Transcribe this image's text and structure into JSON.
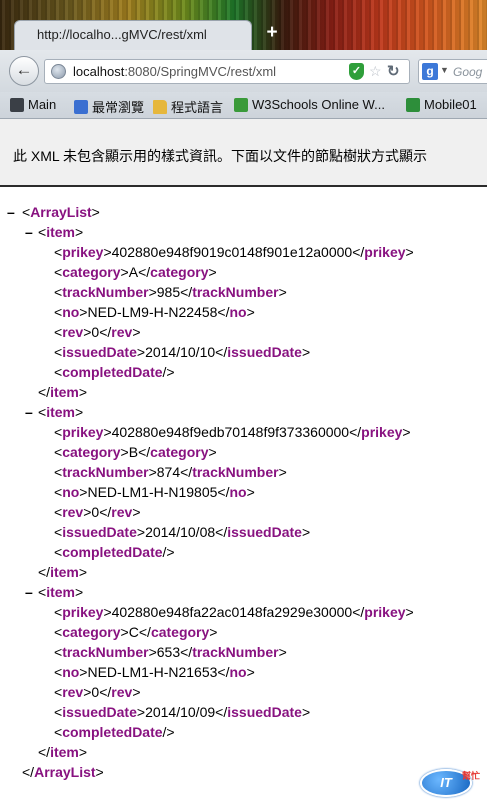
{
  "browser": {
    "tab_title": "http://localho...gMVC/rest/xml",
    "new_tab": "+",
    "url_host": "localhost",
    "url_rest": ":8080/SpringMVC/rest/xml",
    "search_engine": "g",
    "search_placeholder": "Goog",
    "bookmarks": [
      {
        "label": "Main",
        "icon": "page-icon"
      },
      {
        "label": "最常瀏覽",
        "icon": "people-icon"
      },
      {
        "label": "程式語言",
        "icon": "folder-icon"
      },
      {
        "label": "W3Schools Online W...",
        "icon": "w3schools-icon"
      },
      {
        "label": "Mobile01",
        "icon": "mobile01-icon"
      }
    ]
  },
  "notice": "此 XML 未包含顯示用的樣式資訊。下面以文件的節點樹狀方式顯示",
  "xml": {
    "root_tag": "ArrayList",
    "item_tag": "item",
    "items": [
      {
        "prikey": "402880e948f9019c0148f901e12a0000",
        "category": "A",
        "trackNumber": "985",
        "no": "NED-LM9-H-N22458",
        "rev": "0",
        "issuedDate": "2014/10/10"
      },
      {
        "prikey": "402880e948f9edb70148f9f373360000",
        "category": "B",
        "trackNumber": "874",
        "no": "NED-LM1-H-N19805",
        "rev": "0",
        "issuedDate": "2014/10/08"
      },
      {
        "prikey": "402880e948fa22ac0148fa2929e30000",
        "category": "C",
        "trackNumber": "653",
        "no": "NED-LM1-H-N21653",
        "rev": "0",
        "issuedDate": "2014/10/09"
      }
    ]
  },
  "watermark": {
    "text": "IT",
    "side": "幫忙"
  }
}
